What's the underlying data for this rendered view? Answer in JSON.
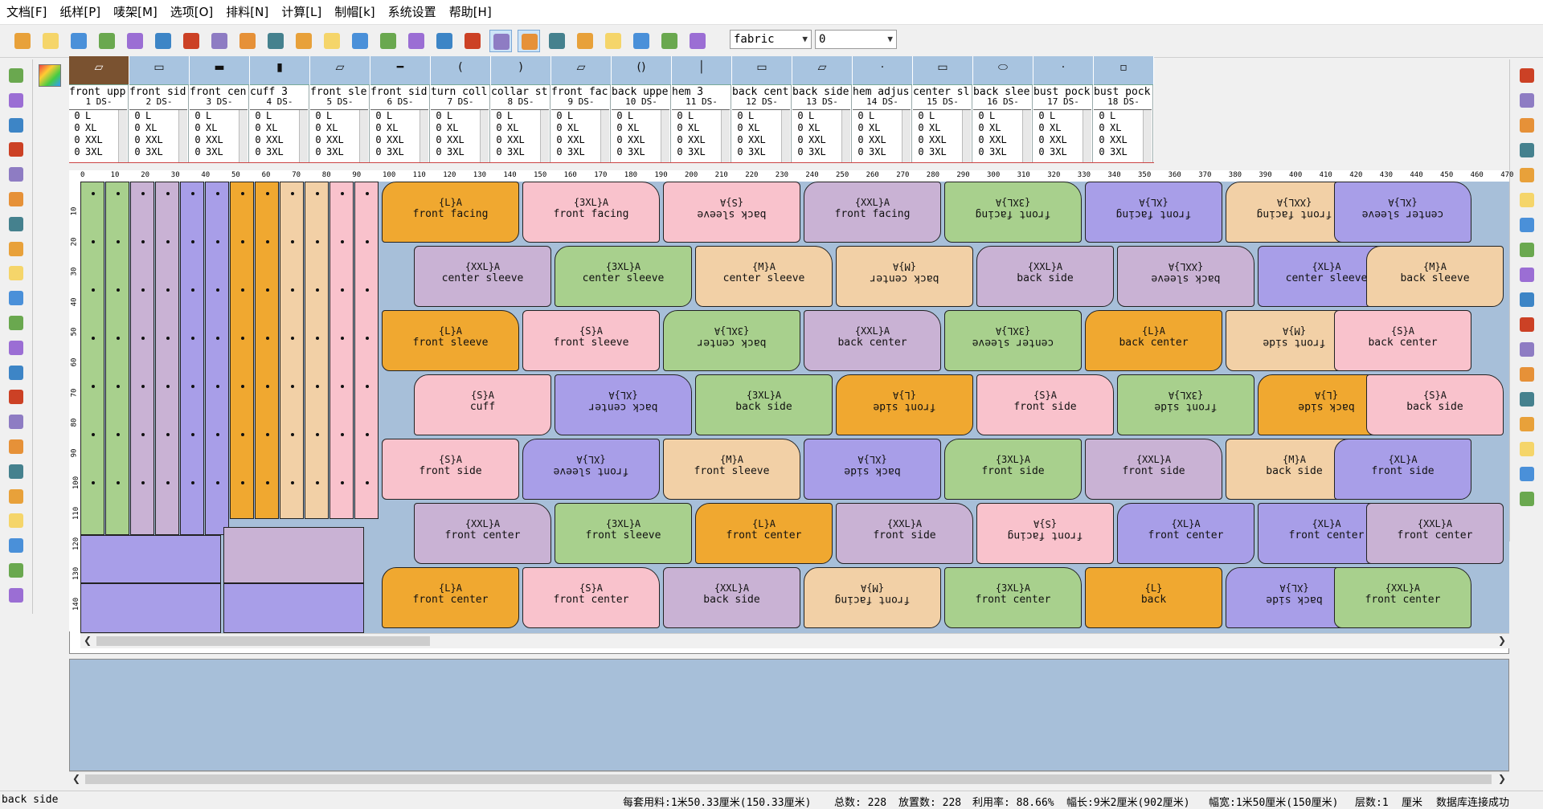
{
  "menu": [
    "文档[F]",
    "纸样[P]",
    "唛架[M]",
    "选项[O]",
    "排料[N]",
    "计算[L]",
    "制帽[k]",
    "系统设置",
    "帮助[H]"
  ],
  "toolbar": {
    "fabric_select": "fabric",
    "number_select": "0",
    "icons": [
      "open-folder-icon",
      "new-file-icon",
      "open-marker-icon",
      "save-icon",
      "save-as-icon",
      "print-icon",
      "plot-icon",
      "zoom-icon",
      "undo-icon",
      "redo-icon",
      "open-pattern-icon",
      "ruler-tool-icon",
      "settings-icon",
      "color-wheel-icon",
      "grid-icon",
      "text-a-icon",
      "import-icon",
      "view-mode-1-icon",
      "view-mode-2-icon",
      "table-icon",
      "pencil-shape-icon",
      "pin-icon",
      "cape-icon",
      "delete-icon",
      "layers-icon"
    ]
  },
  "left_tools": [
    "pointer-icon",
    "zoom-rect-icon",
    "zoom-in-icon",
    "zoom-out-icon",
    "pan-icon",
    "move-pieces-icon",
    "magnify-icon",
    "cross-tool-icon",
    "measure-icon",
    "rotate-icon",
    "cut-icon",
    "copy-icon",
    "split-icon",
    "text-tool-icon",
    "marker-m-icon",
    "refresh-icon",
    "flip-icon",
    "flip-2-icon",
    "align-icon",
    "delete-piece-icon",
    "gear-icon",
    "settings-2-icon"
  ],
  "right_tools": [
    "zoom-icon",
    "zoom-in-icon",
    "zoom-out-icon",
    "cloud-icon",
    "database-icon",
    "upload-icon",
    "download-icon",
    "printer-icon",
    "square-icon",
    "shapes-icon",
    "notes-icon",
    "arrange-icon",
    "stack-icon",
    "move-down-icon",
    "error-icon",
    "layers-icon",
    "grid-icon",
    "export-icon"
  ],
  "pieces": [
    {
      "name": "front upp",
      "num": "1    DS-",
      "glyph": "▱"
    },
    {
      "name": "front sid",
      "num": "2    DS-",
      "glyph": "▭"
    },
    {
      "name": "front cen",
      "num": "3    DS-",
      "glyph": "▬"
    },
    {
      "name": "cuff     3",
      "num": "4    DS-",
      "glyph": "▮"
    },
    {
      "name": "front sle",
      "num": "5    DS-",
      "glyph": "▱"
    },
    {
      "name": "front sid",
      "num": "6    DS-",
      "glyph": "━"
    },
    {
      "name": "turn coll",
      "num": "7    DS-",
      "glyph": "("
    },
    {
      "name": "collar st",
      "num": "8    DS-",
      "glyph": ")"
    },
    {
      "name": "front fac",
      "num": "9    DS-",
      "glyph": "▱"
    },
    {
      "name": "back uppe",
      "num": "10   DS-",
      "glyph": "()"
    },
    {
      "name": "hem     3",
      "num": "11   DS-",
      "glyph": "│"
    },
    {
      "name": "back cent",
      "num": "12   DS-",
      "glyph": "▭"
    },
    {
      "name": "back side",
      "num": "13   DS-",
      "glyph": "▱"
    },
    {
      "name": "hem adjus",
      "num": "14   DS-",
      "glyph": "·"
    },
    {
      "name": "center sl",
      "num": "15   DS-",
      "glyph": "▭"
    },
    {
      "name": "back slee",
      "num": "16   DS-",
      "glyph": "⬭"
    },
    {
      "name": "bust pock",
      "num": "17   DS-",
      "glyph": "·"
    },
    {
      "name": "bust pock",
      "num": "18   DS-",
      "glyph": "▫"
    }
  ],
  "size_rows": [
    {
      "qty": "0",
      "size": "L"
    },
    {
      "qty": "0",
      "size": "XL"
    },
    {
      "qty": "0",
      "size": "XXL"
    },
    {
      "qty": "0",
      "size": "3XL"
    }
  ],
  "ruler_top": [
    "0",
    "10",
    "20",
    "30",
    "40",
    "50",
    "60",
    "70",
    "80",
    "90",
    "100",
    "110",
    "120",
    "130",
    "140",
    "150",
    "160",
    "170",
    "180",
    "190",
    "200",
    "210",
    "220",
    "230",
    "240",
    "250",
    "260",
    "270",
    "280",
    "290",
    "300",
    "310",
    "320",
    "330",
    "340",
    "350",
    "360",
    "370",
    "380",
    "390",
    "400",
    "410",
    "420",
    "430",
    "440",
    "450",
    "460",
    "470"
  ],
  "ruler_left": [
    "10",
    "20",
    "30",
    "40",
    "50",
    "60",
    "70",
    "80",
    "90",
    "100",
    "110",
    "120",
    "130",
    "140"
  ],
  "marker_pieces": [
    {
      "tag": "{L}A",
      "label": "front facing",
      "flip": false,
      "color": "#f0a830"
    },
    {
      "tag": "{3XL}A",
      "label": "front facing",
      "flip": false,
      "color": "#f9c2cc"
    },
    {
      "tag": "{S}A",
      "label": "back sleeve",
      "flip": true,
      "color": "#f9c2cc"
    },
    {
      "tag": "{XXL}A",
      "label": "front facing",
      "flip": false,
      "color": "#c9b2d4"
    },
    {
      "tag": "{3XL}A",
      "label": "front facing",
      "flip": true,
      "color": "#a8d08d"
    },
    {
      "tag": "{XL}A",
      "label": "front facing",
      "flip": true,
      "color": "#a89ee8"
    },
    {
      "tag": "{XXL}A",
      "label": "front facing",
      "flip": true,
      "color": "#f2d0a6"
    },
    {
      "tag": "{XL}A",
      "label": "center sleeve",
      "flip": true,
      "color": "#a89ee8"
    },
    {
      "tag": "{XXL}A",
      "label": "center sleeve",
      "flip": false,
      "color": "#c9b2d4"
    },
    {
      "tag": "{3XL}A",
      "label": "center sleeve",
      "flip": false,
      "color": "#a8d08d"
    },
    {
      "tag": "{M}A",
      "label": "center sleeve",
      "flip": false,
      "color": "#f2d0a6"
    },
    {
      "tag": "{M}A",
      "label": "back center",
      "flip": true,
      "color": "#f2d0a6"
    },
    {
      "tag": "{XXL}A",
      "label": "back side",
      "flip": false,
      "color": "#c9b2d4"
    },
    {
      "tag": "{XXL}A",
      "label": "back sleeve",
      "flip": true,
      "color": "#c9b2d4"
    },
    {
      "tag": "{XL}A",
      "label": "center sleeve",
      "flip": false,
      "color": "#a89ee8"
    },
    {
      "tag": "{M}A",
      "label": "back sleeve",
      "flip": false,
      "color": "#f2d0a6"
    },
    {
      "tag": "{L}A",
      "label": "front sleeve",
      "flip": false,
      "color": "#f0a830"
    },
    {
      "tag": "{S}A",
      "label": "front sleeve",
      "flip": false,
      "color": "#f9c2cc"
    },
    {
      "tag": "{3XL}A",
      "label": "back center",
      "flip": true,
      "color": "#a8d08d"
    },
    {
      "tag": "{XXL}A",
      "label": "back center",
      "flip": false,
      "color": "#c9b2d4"
    },
    {
      "tag": "{3XL}A",
      "label": "center sleeve",
      "flip": true,
      "color": "#a8d08d"
    },
    {
      "tag": "{L}A",
      "label": "back center",
      "flip": false,
      "color": "#f0a830"
    },
    {
      "tag": "{M}A",
      "label": "front side",
      "flip": true,
      "color": "#f2d0a6"
    },
    {
      "tag": "{S}A",
      "label": "back center",
      "flip": false,
      "color": "#f9c2cc"
    },
    {
      "tag": "{S}A",
      "label": "cuff",
      "flip": false,
      "color": "#f9c2cc"
    },
    {
      "tag": "{XL}A",
      "label": "back center",
      "flip": true,
      "color": "#a89ee8"
    },
    {
      "tag": "{3XL}A",
      "label": "back side",
      "flip": false,
      "color": "#a8d08d"
    },
    {
      "tag": "{L}A",
      "label": "front side",
      "flip": true,
      "color": "#f0a830"
    },
    {
      "tag": "{S}A",
      "label": "front side",
      "flip": false,
      "color": "#f9c2cc"
    },
    {
      "tag": "{3XL}A",
      "label": "front side",
      "flip": true,
      "color": "#a8d08d"
    },
    {
      "tag": "{L}A",
      "label": "back side",
      "flip": true,
      "color": "#f0a830"
    },
    {
      "tag": "{S}A",
      "label": "back side",
      "flip": false,
      "color": "#f9c2cc"
    },
    {
      "tag": "{S}A",
      "label": "front side",
      "flip": false,
      "color": "#f9c2cc"
    },
    {
      "tag": "{XL}A",
      "label": "front sleeve",
      "flip": true,
      "color": "#a89ee8"
    },
    {
      "tag": "{M}A",
      "label": "front sleeve",
      "flip": false,
      "color": "#f2d0a6"
    },
    {
      "tag": "{XL}A",
      "label": "back side",
      "flip": true,
      "color": "#a89ee8"
    },
    {
      "tag": "{3XL}A",
      "label": "front side",
      "flip": false,
      "color": "#a8d08d"
    },
    {
      "tag": "{XXL}A",
      "label": "front side",
      "flip": false,
      "color": "#c9b2d4"
    },
    {
      "tag": "{M}A",
      "label": "back side",
      "flip": false,
      "color": "#f2d0a6"
    },
    {
      "tag": "{XL}A",
      "label": "front side",
      "flip": false,
      "color": "#a89ee8"
    },
    {
      "tag": "{XXL}A",
      "label": "front center",
      "flip": false,
      "color": "#c9b2d4"
    },
    {
      "tag": "{3XL}A",
      "label": "front sleeve",
      "flip": false,
      "color": "#a8d08d"
    },
    {
      "tag": "{L}A",
      "label": "front center",
      "flip": false,
      "color": "#f0a830"
    },
    {
      "tag": "{XXL}A",
      "label": "front side",
      "flip": false,
      "color": "#c9b2d4"
    },
    {
      "tag": "{S}A",
      "label": "front facing",
      "flip": true,
      "color": "#f9c2cc"
    },
    {
      "tag": "{XL}A",
      "label": "front center",
      "flip": false,
      "color": "#a89ee8"
    },
    {
      "tag": "{XL}A",
      "label": "front center",
      "flip": false,
      "color": "#a89ee8"
    },
    {
      "tag": "{XXL}A",
      "label": "front center",
      "flip": false,
      "color": "#c9b2d4"
    },
    {
      "tag": "{L}A",
      "label": "front center",
      "flip": false,
      "color": "#f0a830"
    },
    {
      "tag": "{S}A",
      "label": "front center",
      "flip": false,
      "color": "#f9c2cc"
    },
    {
      "tag": "{XXL}A",
      "label": "back side",
      "flip": false,
      "color": "#c9b2d4"
    },
    {
      "tag": "{M}A",
      "label": "front facing",
      "flip": true,
      "color": "#f2d0a6"
    },
    {
      "tag": "{3XL}A",
      "label": "front center",
      "flip": false,
      "color": "#a8d08d"
    },
    {
      "tag": "{L}",
      "label": "back",
      "flip": false,
      "color": "#f0a830"
    },
    {
      "tag": "{XL}A",
      "label": "back side",
      "flip": true,
      "color": "#a89ee8"
    },
    {
      "tag": "{XXL}A",
      "label": "front center",
      "flip": false,
      "color": "#a8d08d"
    }
  ],
  "status": {
    "selected_piece": "back side",
    "usage": "每套用料:1米50.33厘米(150.33厘米)",
    "total": "总数: 228",
    "placed": "放置数: 228",
    "utilization": "利用率: 88.66%",
    "length": "幅长:9米2厘米(902厘米)",
    "width": "幅宽:1米50厘米(150厘米)",
    "layers": "层数:1",
    "unit": "厘米",
    "db": "数据库连接成功"
  },
  "colors": {
    "orange": "#f0a830",
    "pink": "#f9c2cc",
    "purple": "#a89ee8",
    "green": "#a8d08d",
    "lilac": "#c9b2d4",
    "tan": "#f2d0a6",
    "fabric": "#a7bfd9"
  }
}
